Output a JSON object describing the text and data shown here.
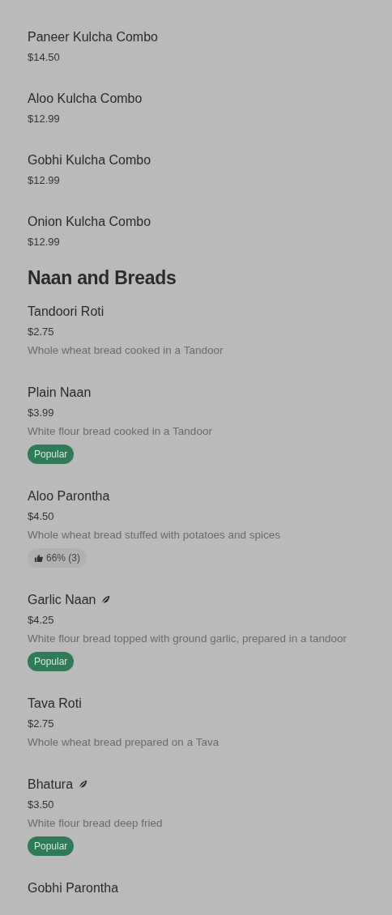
{
  "sections": [
    {
      "items": [
        {
          "name": "Paneer Kulcha Combo",
          "price": "$14.50"
        },
        {
          "name": "Aloo Kulcha Combo",
          "price": "$12.99"
        },
        {
          "name": "Gobhi Kulcha Combo",
          "price": "$12.99"
        },
        {
          "name": "Onion Kulcha Combo",
          "price": "$12.99"
        }
      ]
    },
    {
      "title": "Naan and Breads",
      "items": [
        {
          "name": "Tandoori Roti",
          "price": "$2.75",
          "description": "Whole wheat bread cooked in a Tandoor"
        },
        {
          "name": "Plain Naan",
          "price": "$3.99",
          "description": "White flour bread cooked in a Tandoor",
          "badge": {
            "kind": "popular",
            "text": "Popular"
          }
        },
        {
          "name": "Aloo Parontha",
          "price": "$4.50",
          "description": "Whole wheat bread stuffed with potatoes and spices",
          "badge": {
            "kind": "rating",
            "text": "66% (3)"
          }
        },
        {
          "name": "Garlic Naan",
          "vegetarian": true,
          "price": "$4.25",
          "description": "White flour bread topped with ground garlic, prepared in a tandoor",
          "badge": {
            "kind": "popular",
            "text": "Popular"
          }
        },
        {
          "name": "Tava Roti",
          "price": "$2.75",
          "description": "Whole wheat bread prepared on a Tava"
        },
        {
          "name": "Bhatura",
          "vegetarian": true,
          "price": "$3.50",
          "description": "White flour bread deep fried",
          "badge": {
            "kind": "popular",
            "text": "Popular"
          }
        },
        {
          "name": "Gobhi Parontha"
        }
      ]
    }
  ]
}
